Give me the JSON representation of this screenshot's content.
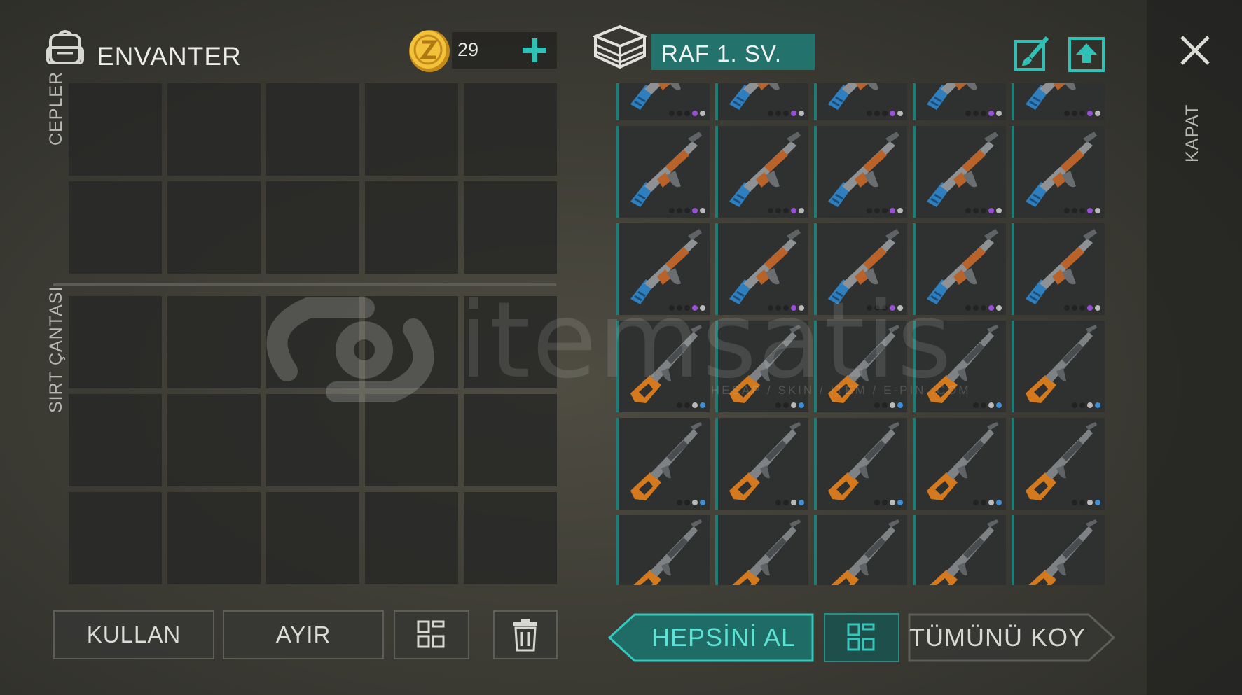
{
  "inventory": {
    "title": "ENVANTER",
    "coins": "29",
    "pockets_label": "CEPLER",
    "backpack_label": "SIRT ÇANTASI"
  },
  "storage": {
    "name": "RAF 1. SV.",
    "rows": [
      {
        "weapon": "ak-rifle-icon",
        "dots": [
          "#222",
          "#222",
          "#222",
          "#9a4fd8",
          "#b9b9b9"
        ]
      },
      {
        "weapon": "ak-rifle-icon",
        "dots": [
          "#222",
          "#222",
          "#222",
          "#9a4fd8",
          "#b9b9b9"
        ]
      },
      {
        "weapon": "ak-rifle-icon",
        "dots": [
          "#222",
          "#222",
          "#222",
          "#9a4fd8",
          "#b9b9b9"
        ]
      },
      {
        "weapon": "sniper-rifle-icon",
        "dots": [
          "#222",
          "#222",
          "#b9b9b9",
          "#3d8fd8"
        ]
      },
      {
        "weapon": "sniper-rifle-icon",
        "dots": [
          "#222",
          "#222",
          "#b9b9b9",
          "#3d8fd8"
        ]
      },
      {
        "weapon": "sniper-rifle-icon",
        "dots": [
          "#222",
          "#222",
          "#b9b9b9",
          "#3d8fd8"
        ]
      }
    ]
  },
  "close_label": "KAPAT",
  "buttons": {
    "use": "KULLAN",
    "split": "AYIR",
    "take_all": "HEPSİNİ AL",
    "put_all": "TÜMÜNÜ KOY"
  },
  "watermark": {
    "brand": "itemsatis",
    "tagline": "HESAP / SKIN / ITEM / E-PIN .COM"
  },
  "colors": {
    "accent_teal": "#23726c",
    "accent_teal_light": "#34c8bc",
    "rarity_purple": "#9a4fd8",
    "rarity_blue": "#3d8fd8"
  }
}
